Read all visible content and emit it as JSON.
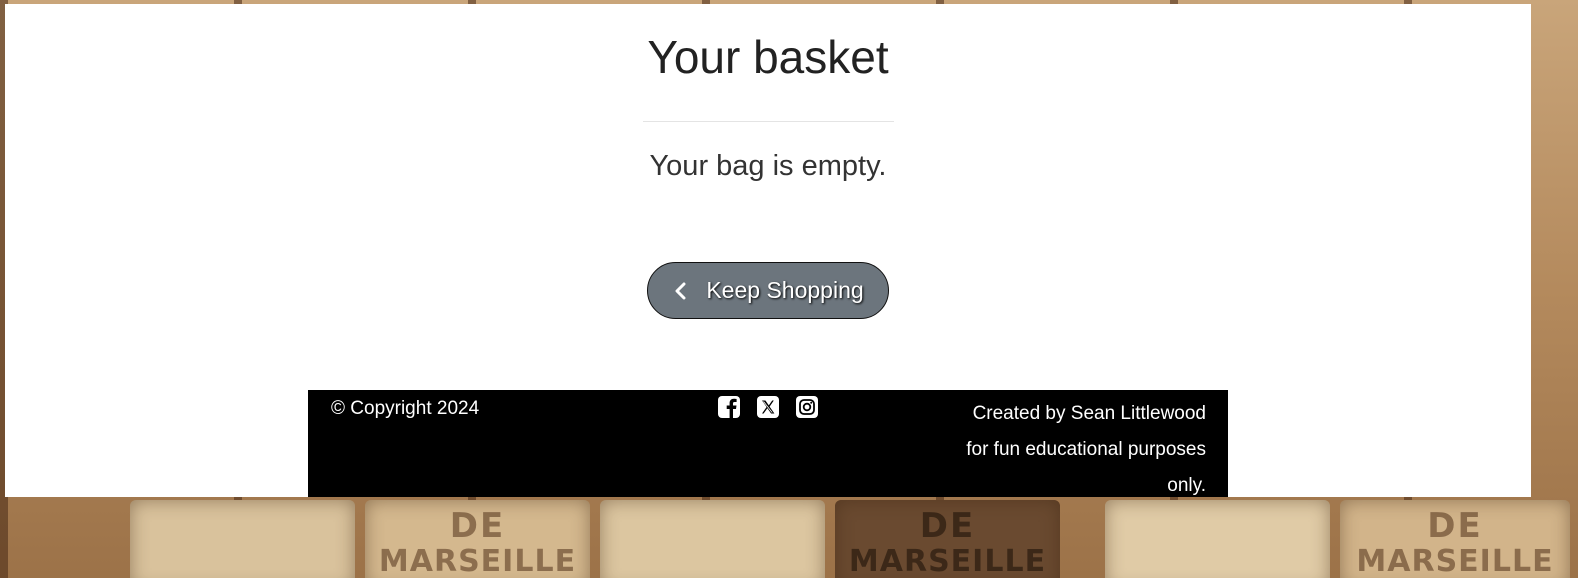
{
  "page": {
    "title": "Your basket",
    "empty_message": "Your bag is empty."
  },
  "actions": {
    "keep_shopping_label": "Keep Shopping",
    "keep_shopping_icon": "chevron-left-icon"
  },
  "footer": {
    "copyright": "© Copyright 2024",
    "social": [
      {
        "name": "facebook",
        "icon": "facebook-icon"
      },
      {
        "name": "x",
        "icon": "x-icon"
      },
      {
        "name": "instagram",
        "icon": "instagram-icon"
      }
    ],
    "credits_line1": "Created by Sean Littlewood",
    "credits_line2": "for fun educational purposes",
    "credits_line3": "only."
  },
  "background": {
    "soap_text_1": "DE",
    "soap_text_2": "MARSEILLE"
  },
  "colors": {
    "button": "#6c757d",
    "footer": "#000000",
    "panel": "#ffffff"
  }
}
